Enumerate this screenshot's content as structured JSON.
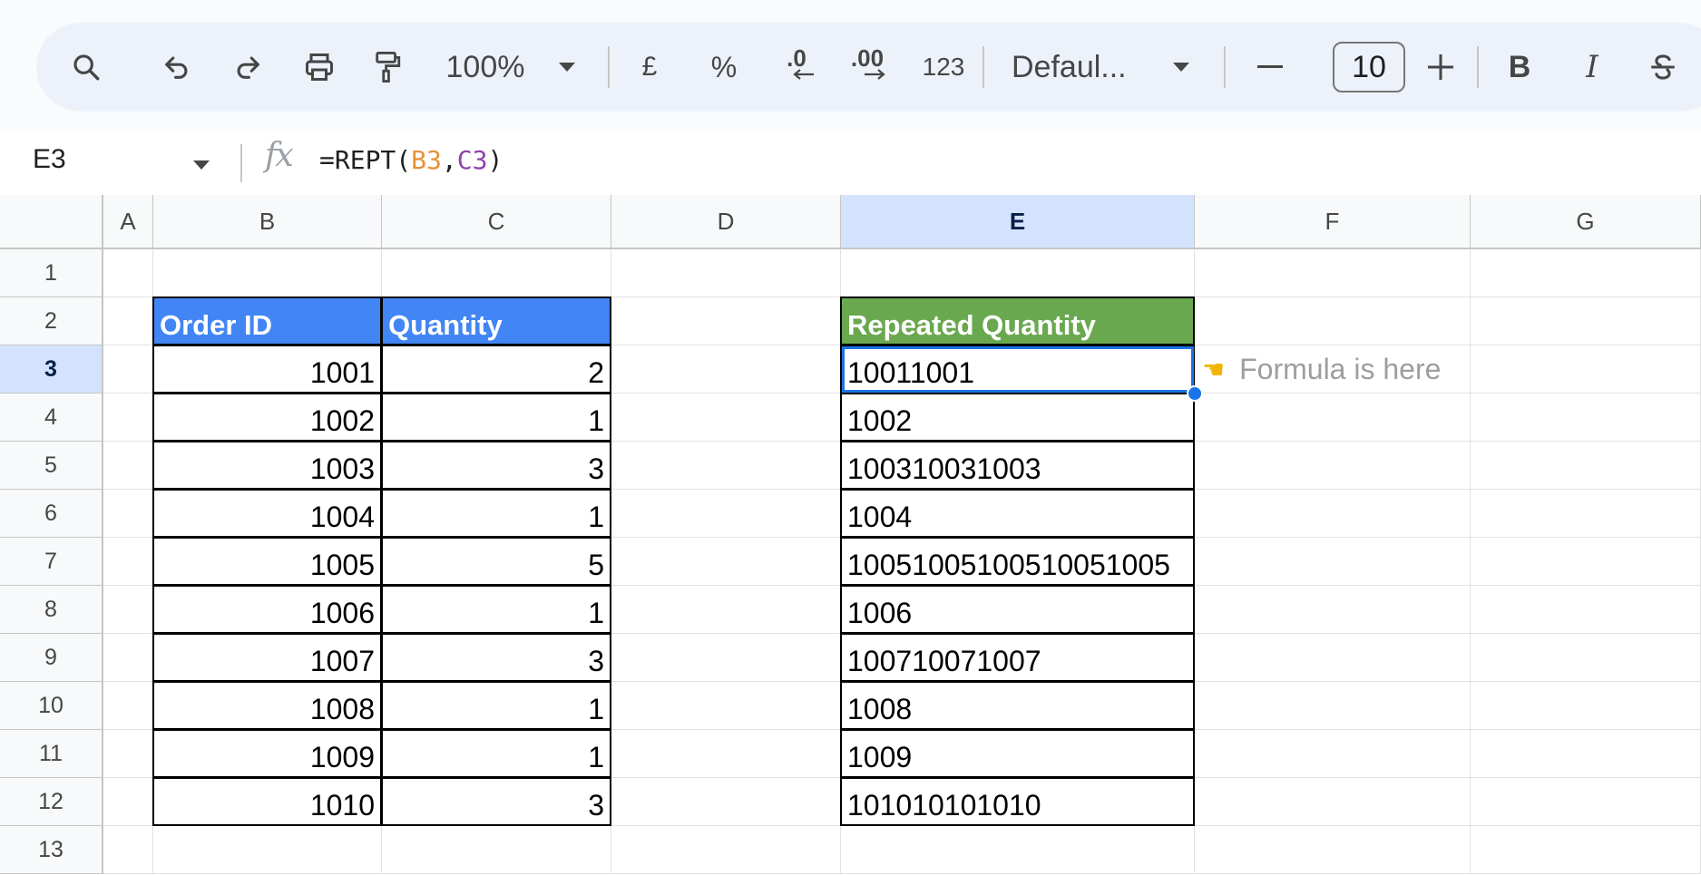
{
  "toolbar": {
    "zoom": "100%",
    "currency": "£",
    "percent": "%",
    "decrease_decimal": ".0",
    "increase_decimal": ".00",
    "more_formats": "123",
    "font": "Defaul...",
    "font_size": "10",
    "bold": "B",
    "italic": "I",
    "accent_color": "#edf2fa"
  },
  "formula_bar": {
    "name_box": "E3",
    "fx_label": "fx",
    "formula_prefix": "=REPT(",
    "formula_ref1": "B3",
    "formula_comma": ",",
    "formula_ref2": "C3",
    "formula_suffix": ")"
  },
  "columns": [
    "A",
    "B",
    "C",
    "D",
    "E",
    "F",
    "G"
  ],
  "rows": [
    "1",
    "2",
    "3",
    "4",
    "5",
    "6",
    "7",
    "8",
    "9",
    "10",
    "11",
    "12",
    "13"
  ],
  "table": {
    "headers": {
      "order_id": "Order ID",
      "quantity": "Quantity",
      "repeated": "Repeated Quantity"
    },
    "order_ids": [
      "1001",
      "1002",
      "1003",
      "1004",
      "1005",
      "1006",
      "1007",
      "1008",
      "1009",
      "1010"
    ],
    "quantities": [
      "2",
      "1",
      "3",
      "1",
      "5",
      "1",
      "3",
      "1",
      "1",
      "3"
    ],
    "repeated": [
      "10011001",
      "1002",
      "100310031003",
      "1004",
      "10051005100510051005",
      "1006",
      "100710071007",
      "1008",
      "1009",
      "101010101010"
    ]
  },
  "note": {
    "icon": "pointing-hand-icon",
    "text": "Formula is here"
  },
  "selection": {
    "cell": "E3",
    "color": "#1a73e8"
  },
  "colors": {
    "header_blue": "#4285f4",
    "header_green": "#6aa84f",
    "selected_header": "#d3e3fd"
  }
}
